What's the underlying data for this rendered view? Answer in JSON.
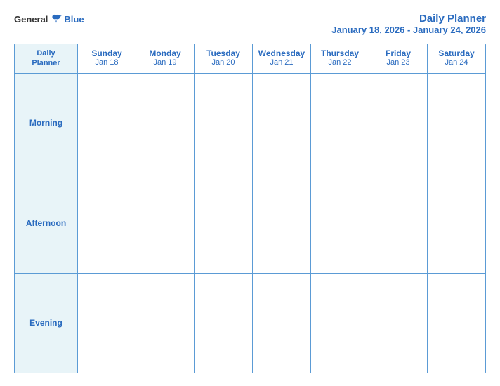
{
  "header": {
    "logo": {
      "general": "General",
      "blue": "Blue"
    },
    "title": "Daily Planner",
    "subtitle": "January 18, 2026 - January 24, 2026"
  },
  "calendar": {
    "label_col": {
      "line1": "Daily",
      "line2": "Planner"
    },
    "days": [
      {
        "name": "Sunday",
        "date": "Jan 18"
      },
      {
        "name": "Monday",
        "date": "Jan 19"
      },
      {
        "name": "Tuesday",
        "date": "Jan 20"
      },
      {
        "name": "Wednesday",
        "date": "Jan 21"
      },
      {
        "name": "Thursday",
        "date": "Jan 22"
      },
      {
        "name": "Friday",
        "date": "Jan 23"
      },
      {
        "name": "Saturday",
        "date": "Jan 24"
      }
    ],
    "rows": [
      {
        "label": "Morning"
      },
      {
        "label": "Afternoon"
      },
      {
        "label": "Evening"
      }
    ]
  }
}
